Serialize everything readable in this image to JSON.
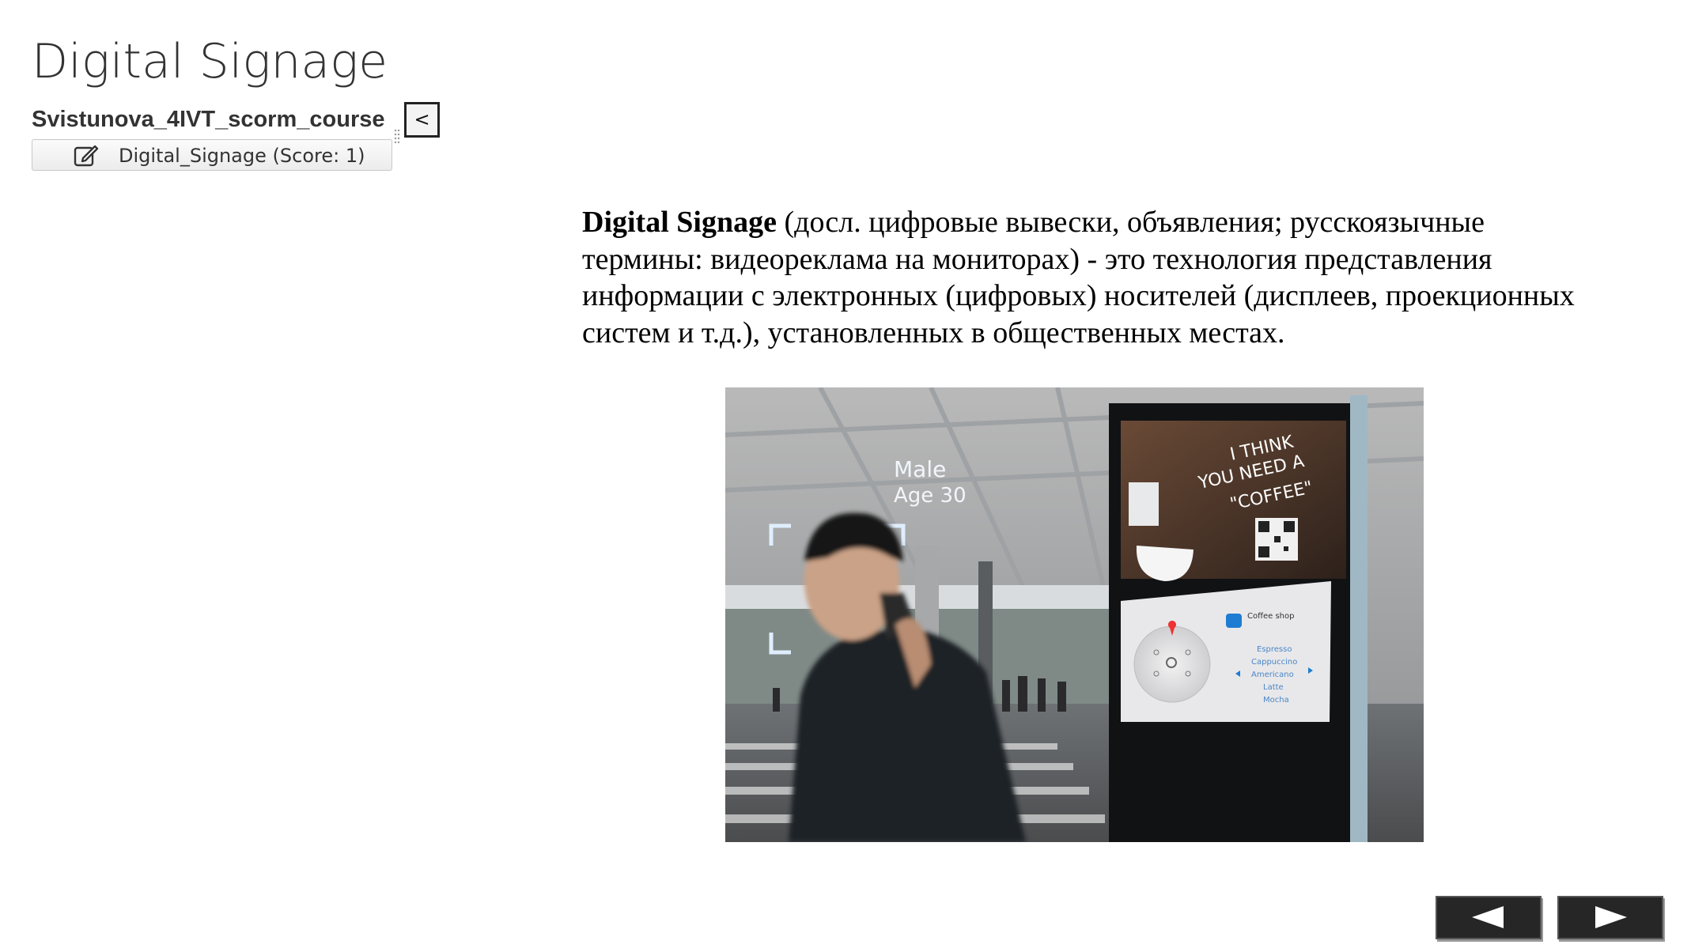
{
  "page": {
    "title": "Digital Signage"
  },
  "toc": {
    "course_title": "Svistunova_4IVT_scorm_course",
    "collapse_label": "<",
    "items": [
      {
        "label": "Digital_Signage (Score: 1)",
        "icon": "edit-icon"
      }
    ]
  },
  "content": {
    "term": "Digital Signage",
    "definition": " (досл. цифровые вывески, объявления; русскоязычные термины: видеореклама на мониторах) - это технология представления информации с электронных (цифровых) носителей (дисплеев, проекционных систем и т.д.), установленных в общественных местах."
  },
  "image": {
    "overlay_gender": "Male",
    "overlay_age": "Age 30",
    "screen_slogan": [
      "I THINK",
      "YOU NEED A",
      "\"COFFEE\""
    ],
    "shop_name": "Coffee shop",
    "menu_items": [
      "Espresso",
      "Cappuccino",
      "Americano",
      "Latte",
      "Mocha"
    ]
  },
  "nav": {
    "prev_icon": "triangle-left-icon",
    "next_icon": "triangle-right-icon"
  },
  "colors": {
    "nav_button_bg": "#262626",
    "screen_panel": "#e8e8ea"
  }
}
